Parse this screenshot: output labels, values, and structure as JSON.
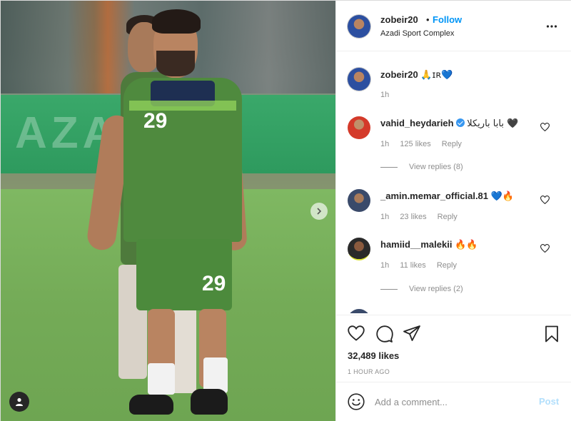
{
  "post": {
    "username": "zobeir20",
    "follow_label": "Follow",
    "separator": "•",
    "location": "Azadi Sport Complex",
    "photo": {
      "banner_text": "AZADI",
      "jersey_number_front": "29",
      "jersey_number_back": "29"
    }
  },
  "caption": {
    "username": "zobeir20",
    "text": "🙏ɪʀ💙",
    "time": "1h"
  },
  "comments": [
    {
      "username": "vahid_heydarieh",
      "verified": true,
      "text": "بابا باریکلا 🖤",
      "time": "1h",
      "likes": "125 likes",
      "reply_label": "Reply",
      "view_replies": "View replies (8)"
    },
    {
      "username": "_amin.memar_official.81",
      "verified": false,
      "text": "💙🔥",
      "time": "1h",
      "likes": "23 likes",
      "reply_label": "Reply"
    },
    {
      "username": "hamiid__malekii",
      "verified": false,
      "text": "🔥🔥",
      "time": "1h",
      "likes": "11 likes",
      "reply_label": "Reply",
      "view_replies": "View replies (2)"
    }
  ],
  "actions": {
    "likes_count": "32,489 likes",
    "time_ago": "1 HOUR AGO"
  },
  "add_comment": {
    "placeholder": "Add a comment...",
    "post_label": "Post"
  },
  "icons": {
    "more": "more-options-icon",
    "like": "heart-icon",
    "comment": "comment-bubble-icon",
    "share": "paper-plane-icon",
    "save": "bookmark-icon",
    "emoji": "emoji-smile-icon",
    "next": "chevron-right-icon",
    "tag": "user-tag-icon"
  },
  "colors": {
    "accent": "#0095f6",
    "post_disabled": "#b2dffc",
    "muted": "#8e8e8e"
  }
}
